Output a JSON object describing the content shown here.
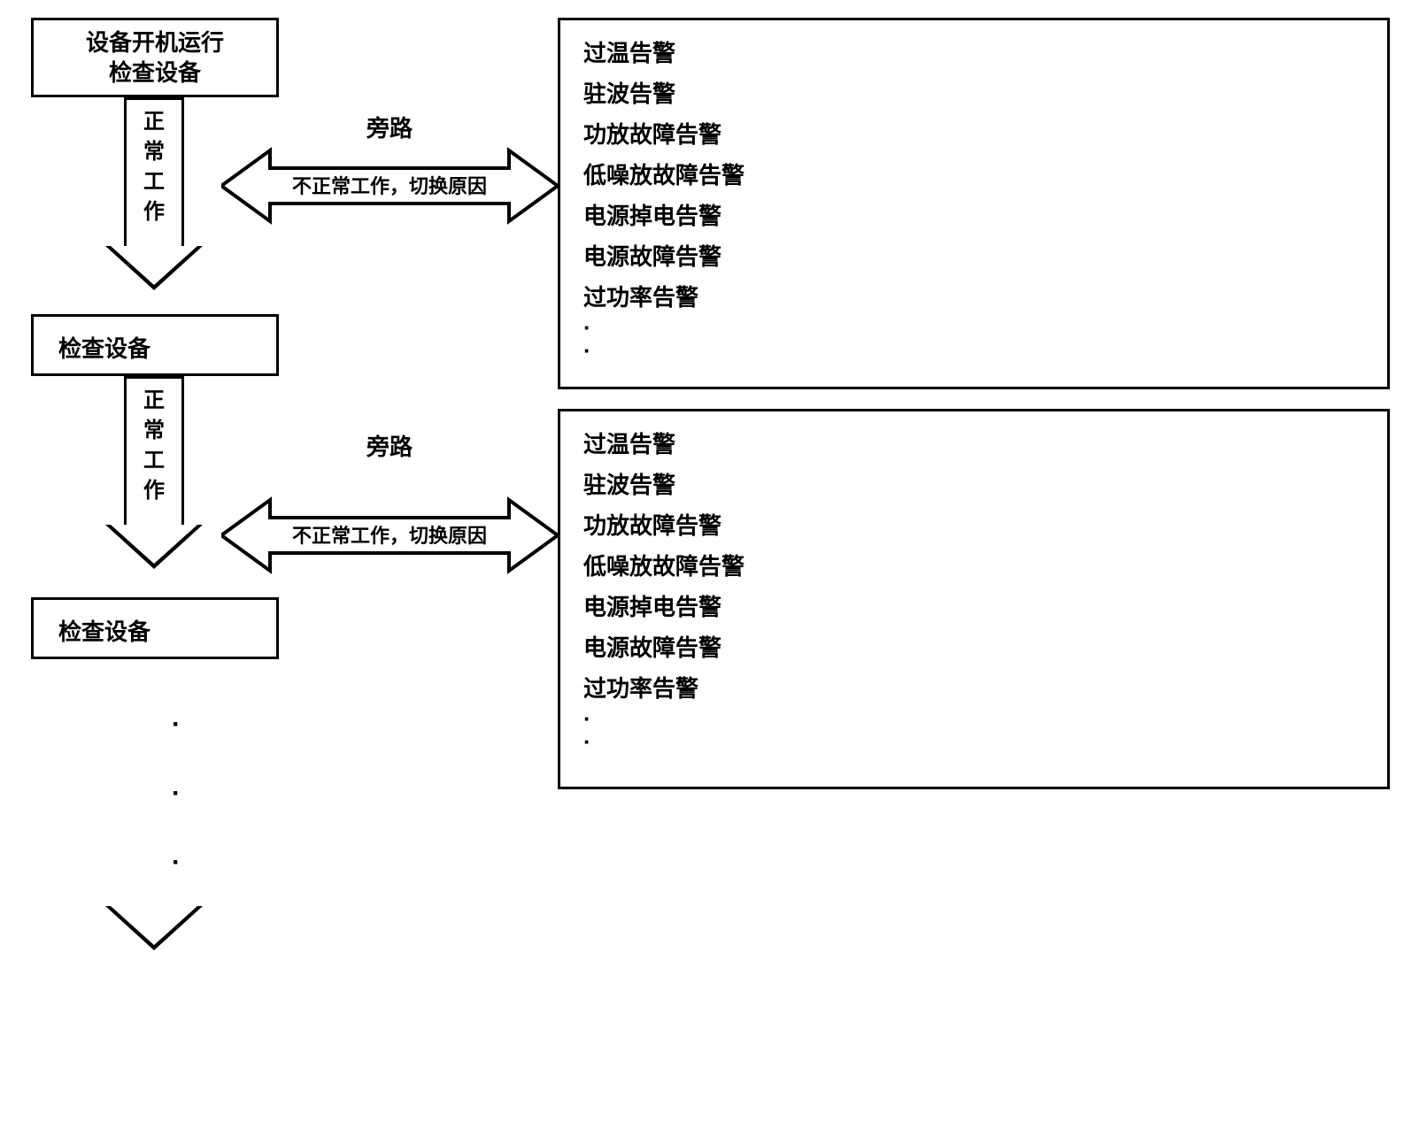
{
  "start": {
    "line1": "设备开机运行",
    "line2": "检查设备"
  },
  "vArrow": {
    "label": "正常工作"
  },
  "checkBox": {
    "label": "检查设备"
  },
  "hArrow": {
    "topLabel": "旁路",
    "innerLabel": "不正常工作，切换原因"
  },
  "alarms": {
    "item0": "过温告警",
    "item1": "驻波告警",
    "item2": "功放故障告警",
    "item3": "低噪放故障告警",
    "item4": "电源掉电告警",
    "item5": "电源故障告警",
    "item6": "过功率告警",
    "ellipsis1": "·",
    "ellipsis2": "·"
  },
  "continuation": {
    "d1": "·",
    "d2": "·",
    "d3": "·"
  }
}
